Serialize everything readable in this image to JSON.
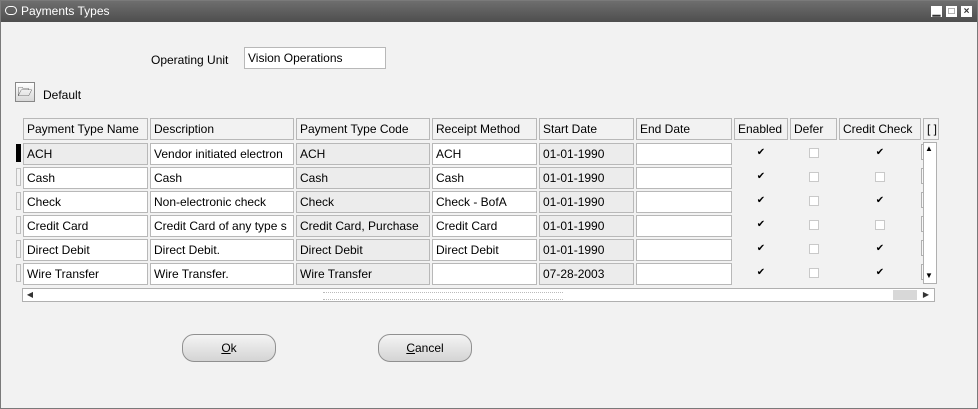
{
  "window": {
    "title": "Payments Types",
    "controls": [
      "minimize-icon",
      "maximize-icon",
      "close-icon"
    ]
  },
  "form": {
    "operating_unit_label": "Operating Unit",
    "operating_unit_value": "Vision Operations",
    "default_label": "Default",
    "default_icon": "folder-open-icon"
  },
  "table": {
    "headers": [
      "Payment Type Name",
      "Description",
      "Payment Type Code",
      "Receipt Method",
      "Start Date",
      "End Date",
      "Enabled",
      "Defer",
      "Credit Check",
      "[ ]"
    ],
    "rows": [
      {
        "name": "ACH",
        "description": "Vendor initiated electron",
        "code": "ACH",
        "receipt_method": "ACH",
        "start_date": "01-01-1990",
        "end_date": "",
        "enabled": true,
        "defer": false,
        "credit_check": true
      },
      {
        "name": "Cash",
        "description": "Cash",
        "code": "Cash",
        "receipt_method": "Cash",
        "start_date": "01-01-1990",
        "end_date": "",
        "enabled": true,
        "defer": false,
        "credit_check": false
      },
      {
        "name": "Check",
        "description": "Non-electronic check",
        "code": "Check",
        "receipt_method": "Check - BofA",
        "start_date": "01-01-1990",
        "end_date": "",
        "enabled": true,
        "defer": false,
        "credit_check": true
      },
      {
        "name": "Credit Card",
        "description": "Credit Card of any type s",
        "code": "Credit Card, Purchase",
        "receipt_method": "Credit Card",
        "start_date": "01-01-1990",
        "end_date": "",
        "enabled": true,
        "defer": false,
        "credit_check": false
      },
      {
        "name": "Direct Debit",
        "description": "Direct Debit.",
        "code": "Direct Debit",
        "receipt_method": "Direct Debit",
        "start_date": "01-01-1990",
        "end_date": "",
        "enabled": true,
        "defer": false,
        "credit_check": true
      },
      {
        "name": "Wire Transfer",
        "description": "Wire Transfer.",
        "code": "Wire Transfer",
        "receipt_method": "",
        "start_date": "07-28-2003",
        "end_date": "",
        "enabled": true,
        "defer": false,
        "credit_check": true
      }
    ]
  },
  "buttons": {
    "ok_mnemonic": "O",
    "ok_rest": "k",
    "cancel_mnemonic": "C",
    "cancel_rest": "ancel"
  }
}
